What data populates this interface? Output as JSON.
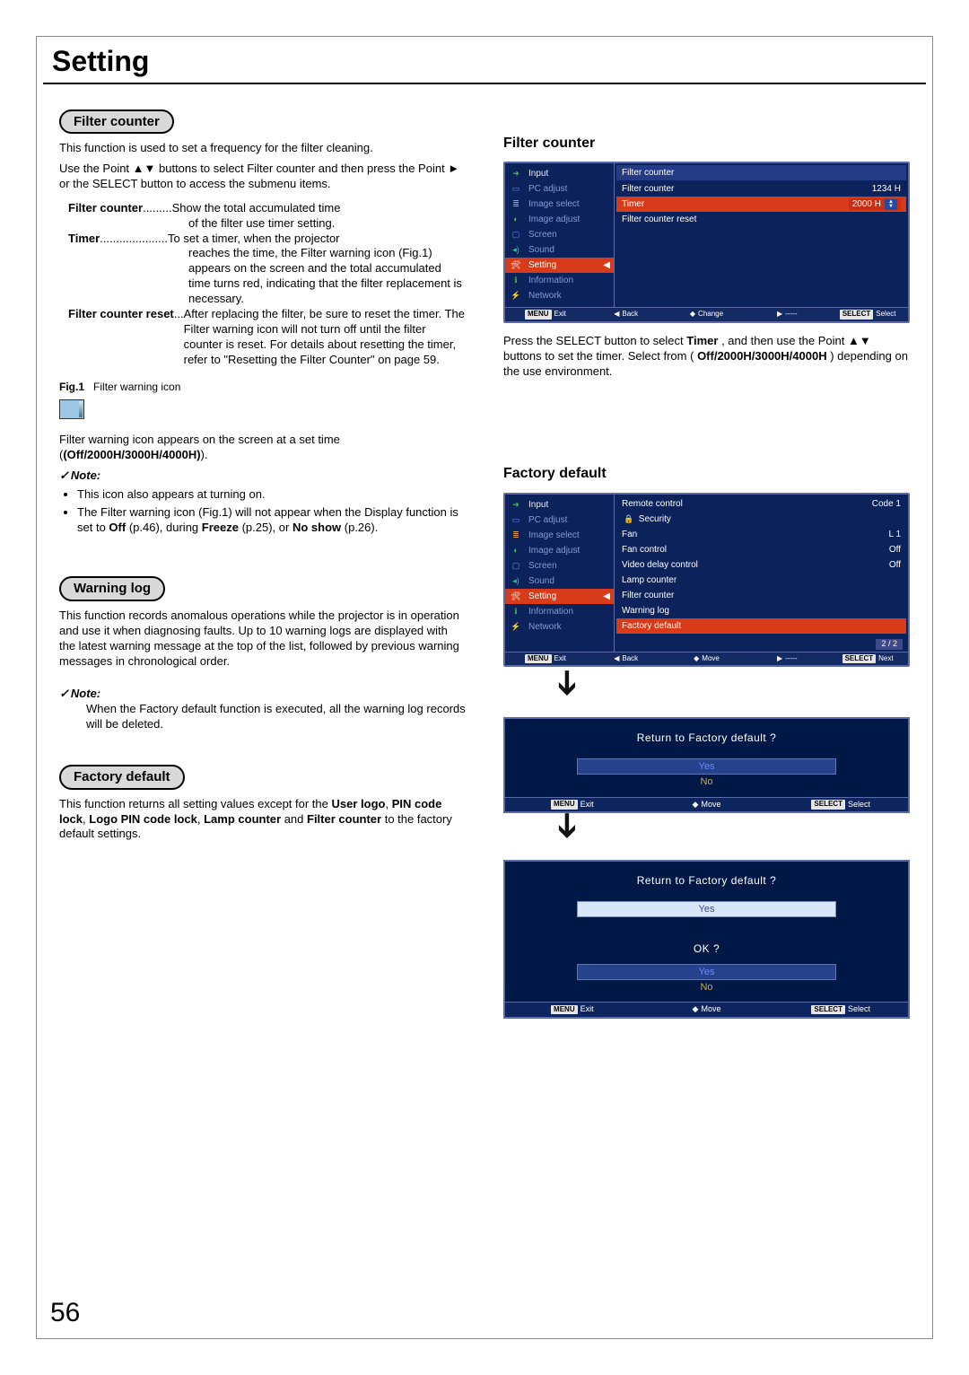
{
  "page": {
    "section_title": "Setting",
    "number": "56"
  },
  "filter_counter": {
    "pill": "Filter counter",
    "intro1": "This function is used to set a frequency for the filter cleaning.",
    "intro2": "Use the Point ▲▼ buttons to select Filter counter and then press the Point ► or the SELECT button to access the submenu items.",
    "rows": {
      "fc_key": "Filter counter",
      "fc_dots": ".........",
      "fc_desc1": "Show the total accumulated time",
      "fc_desc2": "of the filter use timer setting.",
      "tm_key": "Timer",
      "tm_dots": ".....................",
      "tm_desc1": "To set a timer, when the projector",
      "tm_desc2": "reaches the time, the Filter warning icon (Fig.1) appears on the screen and the total accumulated time turns red, indicating that the filter replacement is necessary.",
      "fr_key": "Filter counter reset",
      "fr_dots": "...",
      "fr_desc": "After replacing the filter, be sure to reset the timer. The Filter warning icon will not turn off until the filter counter is reset. For details about resetting the timer, refer to \"Resetting the Filter Counter\" on page 59."
    },
    "fig": {
      "label_bold": "Fig.1",
      "label_rest": "Filter warning icon"
    },
    "after_fig_line1": "Filter warning icon appears on the screen at a set time",
    "after_fig_line2_bold": "(Off/2000H/3000H/4000H)",
    "after_fig_line2_end": ".",
    "note_head": "Note:",
    "note_b1": "This icon also appears at turning on.",
    "note_b2_a": "The Filter warning icon (Fig.1) will not appear when the Display function is set to ",
    "note_b2_off": "Off",
    "note_b2_b": " (p.46), during ",
    "note_b2_freeze": "Freeze",
    "note_b2_c": " (p.25), or ",
    "note_b2_noshow": "No show",
    "note_b2_d": " (p.26)."
  },
  "warning_log": {
    "pill": "Warning log",
    "intro": "This function records anomalous operations while the projector is in operation and use it when diagnosing faults. Up to 10 warning logs are displayed with the latest warning message at the top of the list, followed by previous warning messages in chronological order.",
    "note_head": "Note:",
    "note_text": "When the Factory default function is executed, all the warning log records will be deleted."
  },
  "factory_default": {
    "pill": "Factory default",
    "intro_a": "This function returns all setting values except for the ",
    "bold1": "User logo",
    "comma1": ", ",
    "bold2": "PIN code lock",
    "comma2": ", ",
    "bold3": "Logo PIN code lock",
    "comma3": ", ",
    "bold4": "Lamp counter",
    "and": " and ",
    "bold5": "Filter counter",
    "intro_b": " to the factory default settings."
  },
  "osd_filter": {
    "heading": "Filter counter",
    "side": {
      "input": "Input",
      "pc": "PC adjust",
      "imgsel": "Image select",
      "imgadj": "Image adjust",
      "screen": "Screen",
      "sound": "Sound",
      "setting": "Setting",
      "info": "Information",
      "net": "Network"
    },
    "main": {
      "header": "Filter counter",
      "row1_label": "Filter counter",
      "row1_val": "1234 H",
      "row2_label": "Timer",
      "row2_val": "2000 H",
      "row3_label": "Filter counter reset"
    },
    "footer": {
      "menu": "MENU",
      "exit": "Exit",
      "back": "Back",
      "change": "Change",
      "dashes": "-----",
      "select_label": "SELECT",
      "select": "Select"
    },
    "caption_a": "Press the SELECT button to select ",
    "caption_bold1": "Timer",
    "caption_b": ", and then use the Point ▲▼ buttons to set the timer. Select from (",
    "caption_bold2": "Off/2000H/3000H/4000H",
    "caption_c": ") depending on the use environment."
  },
  "osd_factory": {
    "heading": "Factory default",
    "main": {
      "remote": "Remote control",
      "remote_val": "Code 1",
      "security": "Security",
      "fan": "Fan",
      "fan_val": "L 1",
      "fanctrl": "Fan control",
      "fanctrl_val": "Off",
      "vdc": "Video delay control",
      "vdc_val": "Off",
      "lamp": "Lamp counter",
      "filter": "Filter counter",
      "warn": "Warning log",
      "fd": "Factory default",
      "page": "2 / 2"
    },
    "footer": {
      "menu": "MENU",
      "exit": "Exit",
      "back": "Back",
      "move": "Move",
      "dashes": "-----",
      "select_label": "SELECT",
      "next": "Next"
    }
  },
  "dlg1": {
    "text": "Return to Factory default ?",
    "yes": "Yes",
    "no": "No",
    "menu": "MENU",
    "exit": "Exit",
    "move": "Move",
    "sel_label": "SELECT",
    "sel": "Select"
  },
  "dlg2": {
    "text": "Return to Factory default ?",
    "yes": "Yes",
    "ok": "OK ?",
    "ok_yes": "Yes",
    "ok_no": "No",
    "menu": "MENU",
    "exit": "Exit",
    "move": "Move",
    "sel_label": "SELECT",
    "sel": "Select"
  }
}
